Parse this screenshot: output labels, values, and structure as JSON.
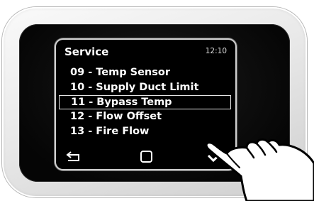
{
  "screen": {
    "title": "Service",
    "clock": "12:10"
  },
  "menu": {
    "items": [
      {
        "label": "09 - Temp Sensor",
        "selected": false
      },
      {
        "label": "10 - Supply Duct Limit",
        "selected": false
      },
      {
        "label": "11 - Bypass Temp",
        "selected": true
      },
      {
        "label": "12 - Flow Offset",
        "selected": false
      },
      {
        "label": "13 - Fire Flow",
        "selected": false
      }
    ]
  },
  "navigation": {
    "back": "back-arrow-icon",
    "home": "square-home-icon",
    "confirm": "checkmark-icon"
  },
  "colors": {
    "screen_background": "#000000",
    "text": "#ffffff",
    "bezel": "#0a0a0a",
    "device_housing": "#ececec"
  }
}
